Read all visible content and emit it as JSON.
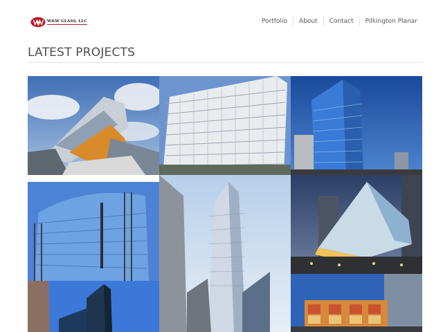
{
  "header": {
    "logo_text": "W&W GLASS, LLC",
    "logo_colors": {
      "mark": "#b51b2b"
    }
  },
  "nav": {
    "items": [
      {
        "label": "Portfolio"
      },
      {
        "label": "About"
      },
      {
        "label": "Contact"
      },
      {
        "label": "Pilkington Planar"
      }
    ]
  },
  "main": {
    "title": "LATEST PROJECTS",
    "projects": [
      {
        "image": "angular-glass-building-orange-soffit"
      },
      {
        "image": "white-grid-office-tower"
      },
      {
        "image": "blue-glass-tower-night-sky"
      },
      {
        "image": "curved-blue-glass-facade"
      },
      {
        "image": "tall-glass-skyscraper"
      },
      {
        "image": "cantilevered-glass-building-dusk"
      },
      {
        "image": "dark-glass-tower-blue-sky"
      },
      {
        "image": "colorful-glass-facade-street"
      }
    ]
  }
}
